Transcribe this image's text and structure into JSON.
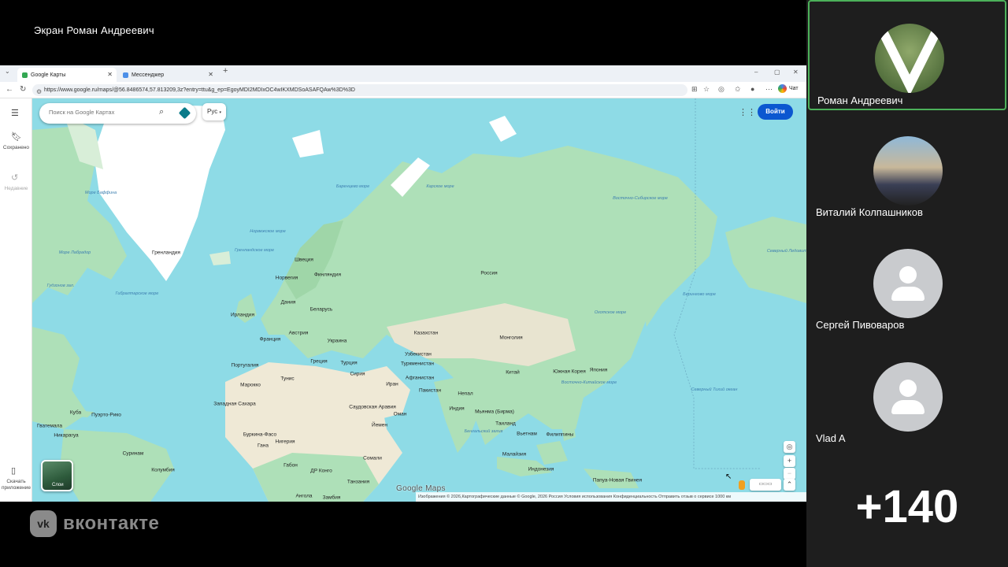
{
  "conference": {
    "screen_title": "Экран Роман Андреевич",
    "brand": "вконтакте",
    "brand_icon": "vk-logo-icon",
    "participants": [
      {
        "name": "Роман Андреевич",
        "avatar": "photo",
        "active": true
      },
      {
        "name": "Виталий Колпашников",
        "avatar": "photo",
        "active": false
      },
      {
        "name": "Сергей Пивоваров",
        "avatar": "placeholder",
        "active": false
      },
      {
        "name": "Vlad A",
        "avatar": "placeholder",
        "active": false
      }
    ],
    "more_count": "+140",
    "colors": {
      "active_border": "#4cb15a",
      "panel_bg": "#1e1e1e"
    }
  },
  "browser": {
    "tabs": [
      {
        "label": "Google Карты",
        "active": true
      },
      {
        "label": "Мессенджер",
        "active": false
      }
    ],
    "url": "https://www.google.ru/maps/@56.8486574,57.813209,3z?entry=ttu&g_ep=EgoyMDI2MDIxOC4wIKXMDSoASAFQAw%3D%3D",
    "chat_label": "Чат"
  },
  "maps": {
    "sidebar": {
      "saved": "Сохранено",
      "recent": "Недавние",
      "download": "Скачать приложение"
    },
    "search_placeholder": "Поиск на Google Картах",
    "lang_button": "Рус",
    "login_button": "Войти",
    "layers_label": "Слои",
    "logo": "Google Maps",
    "attribution": "Изображения © 2026,Картографические данные © Google, 2026    Россия    Условия использования    Конфиденциальность    Отправить отзыв о сервисе    1000 км",
    "colors": {
      "water": "#8edbe6",
      "land": "#aee0b8",
      "login": "#0b57d0"
    },
    "labels": [
      {
        "text": "Гренландия",
        "type": "land"
      },
      {
        "text": "Россия",
        "type": "land"
      },
      {
        "text": "Казахстан",
        "type": "land"
      },
      {
        "text": "Монголия",
        "type": "land"
      },
      {
        "text": "Китай",
        "type": "land"
      },
      {
        "text": "Швеция",
        "type": "land"
      },
      {
        "text": "Норвегия",
        "type": "land"
      },
      {
        "text": "Финляндия",
        "type": "land"
      },
      {
        "text": "Дания",
        "type": "land"
      },
      {
        "text": "Беларусь",
        "type": "land"
      },
      {
        "text": "Ирландия",
        "type": "land"
      },
      {
        "text": "Франция",
        "type": "land"
      },
      {
        "text": "Австрия",
        "type": "land"
      },
      {
        "text": "Украина",
        "type": "land"
      },
      {
        "text": "Португалия",
        "type": "land"
      },
      {
        "text": "Греция",
        "type": "land"
      },
      {
        "text": "Турция",
        "type": "land"
      },
      {
        "text": "Сирия",
        "type": "land"
      },
      {
        "text": "Узбекистан",
        "type": "land"
      },
      {
        "text": "Туркменистан",
        "type": "land"
      },
      {
        "text": "Афганистан",
        "type": "land"
      },
      {
        "text": "Иран",
        "type": "land"
      },
      {
        "text": "Пакистан",
        "type": "land"
      },
      {
        "text": "Непал",
        "type": "land"
      },
      {
        "text": "Индия",
        "type": "land"
      },
      {
        "text": "Мьянма (Бирма)",
        "type": "land"
      },
      {
        "text": "Таиланд",
        "type": "land"
      },
      {
        "text": "Вьетнам",
        "type": "land"
      },
      {
        "text": "Филиппины",
        "type": "land"
      },
      {
        "text": "Малайзия",
        "type": "land"
      },
      {
        "text": "Индонезия",
        "type": "land"
      },
      {
        "text": "Папуа-Новая Гвинея",
        "type": "land"
      },
      {
        "text": "Южная Корея",
        "type": "land"
      },
      {
        "text": "Япония",
        "type": "land"
      },
      {
        "text": "Марокко",
        "type": "land"
      },
      {
        "text": "Тунис",
        "type": "land"
      },
      {
        "text": "Западная Сахара",
        "type": "land"
      },
      {
        "text": "Саудовская Аравия",
        "type": "land"
      },
      {
        "text": "Оман",
        "type": "land"
      },
      {
        "text": "Йемен",
        "type": "land"
      },
      {
        "text": "Буркина-Фасо",
        "type": "land"
      },
      {
        "text": "Гана",
        "type": "land"
      },
      {
        "text": "Нигерия",
        "type": "land"
      },
      {
        "text": "Сомали",
        "type": "land"
      },
      {
        "text": "Габон",
        "type": "land"
      },
      {
        "text": "ДР Конго",
        "type": "land"
      },
      {
        "text": "Танзания",
        "type": "land"
      },
      {
        "text": "Ангола",
        "type": "land"
      },
      {
        "text": "Замбия",
        "type": "land"
      },
      {
        "text": "Куба",
        "type": "land"
      },
      {
        "text": "Пуэрто-Рико",
        "type": "land"
      },
      {
        "text": "Гватемала",
        "type": "land"
      },
      {
        "text": "Никарагуа",
        "type": "land"
      },
      {
        "text": "Суринам",
        "type": "land"
      },
      {
        "text": "Колумбия",
        "type": "land"
      },
      {
        "text": "Северный Ледовитый океан",
        "type": "sea"
      },
      {
        "text": "Северный Тихий океан",
        "type": "sea"
      },
      {
        "text": "Гренландское море",
        "type": "sea"
      },
      {
        "text": "Баренцево море",
        "type": "sea"
      },
      {
        "text": "Карское море",
        "type": "sea"
      },
      {
        "text": "Восточно-Сибирское море",
        "type": "sea"
      },
      {
        "text": "Норвежское море",
        "type": "sea"
      },
      {
        "text": "Море Баффина",
        "type": "sea"
      },
      {
        "text": "Море Лабрадор",
        "type": "sea"
      },
      {
        "text": "Гудзонов зал.",
        "type": "sea"
      },
      {
        "text": "Берингово море",
        "type": "sea"
      },
      {
        "text": "Охотское море",
        "type": "sea"
      },
      {
        "text": "Восточно-Китайское море",
        "type": "sea"
      },
      {
        "text": "Бенгальский залив",
        "type": "sea"
      },
      {
        "text": "Гибралтарское море",
        "type": "sea"
      }
    ]
  }
}
